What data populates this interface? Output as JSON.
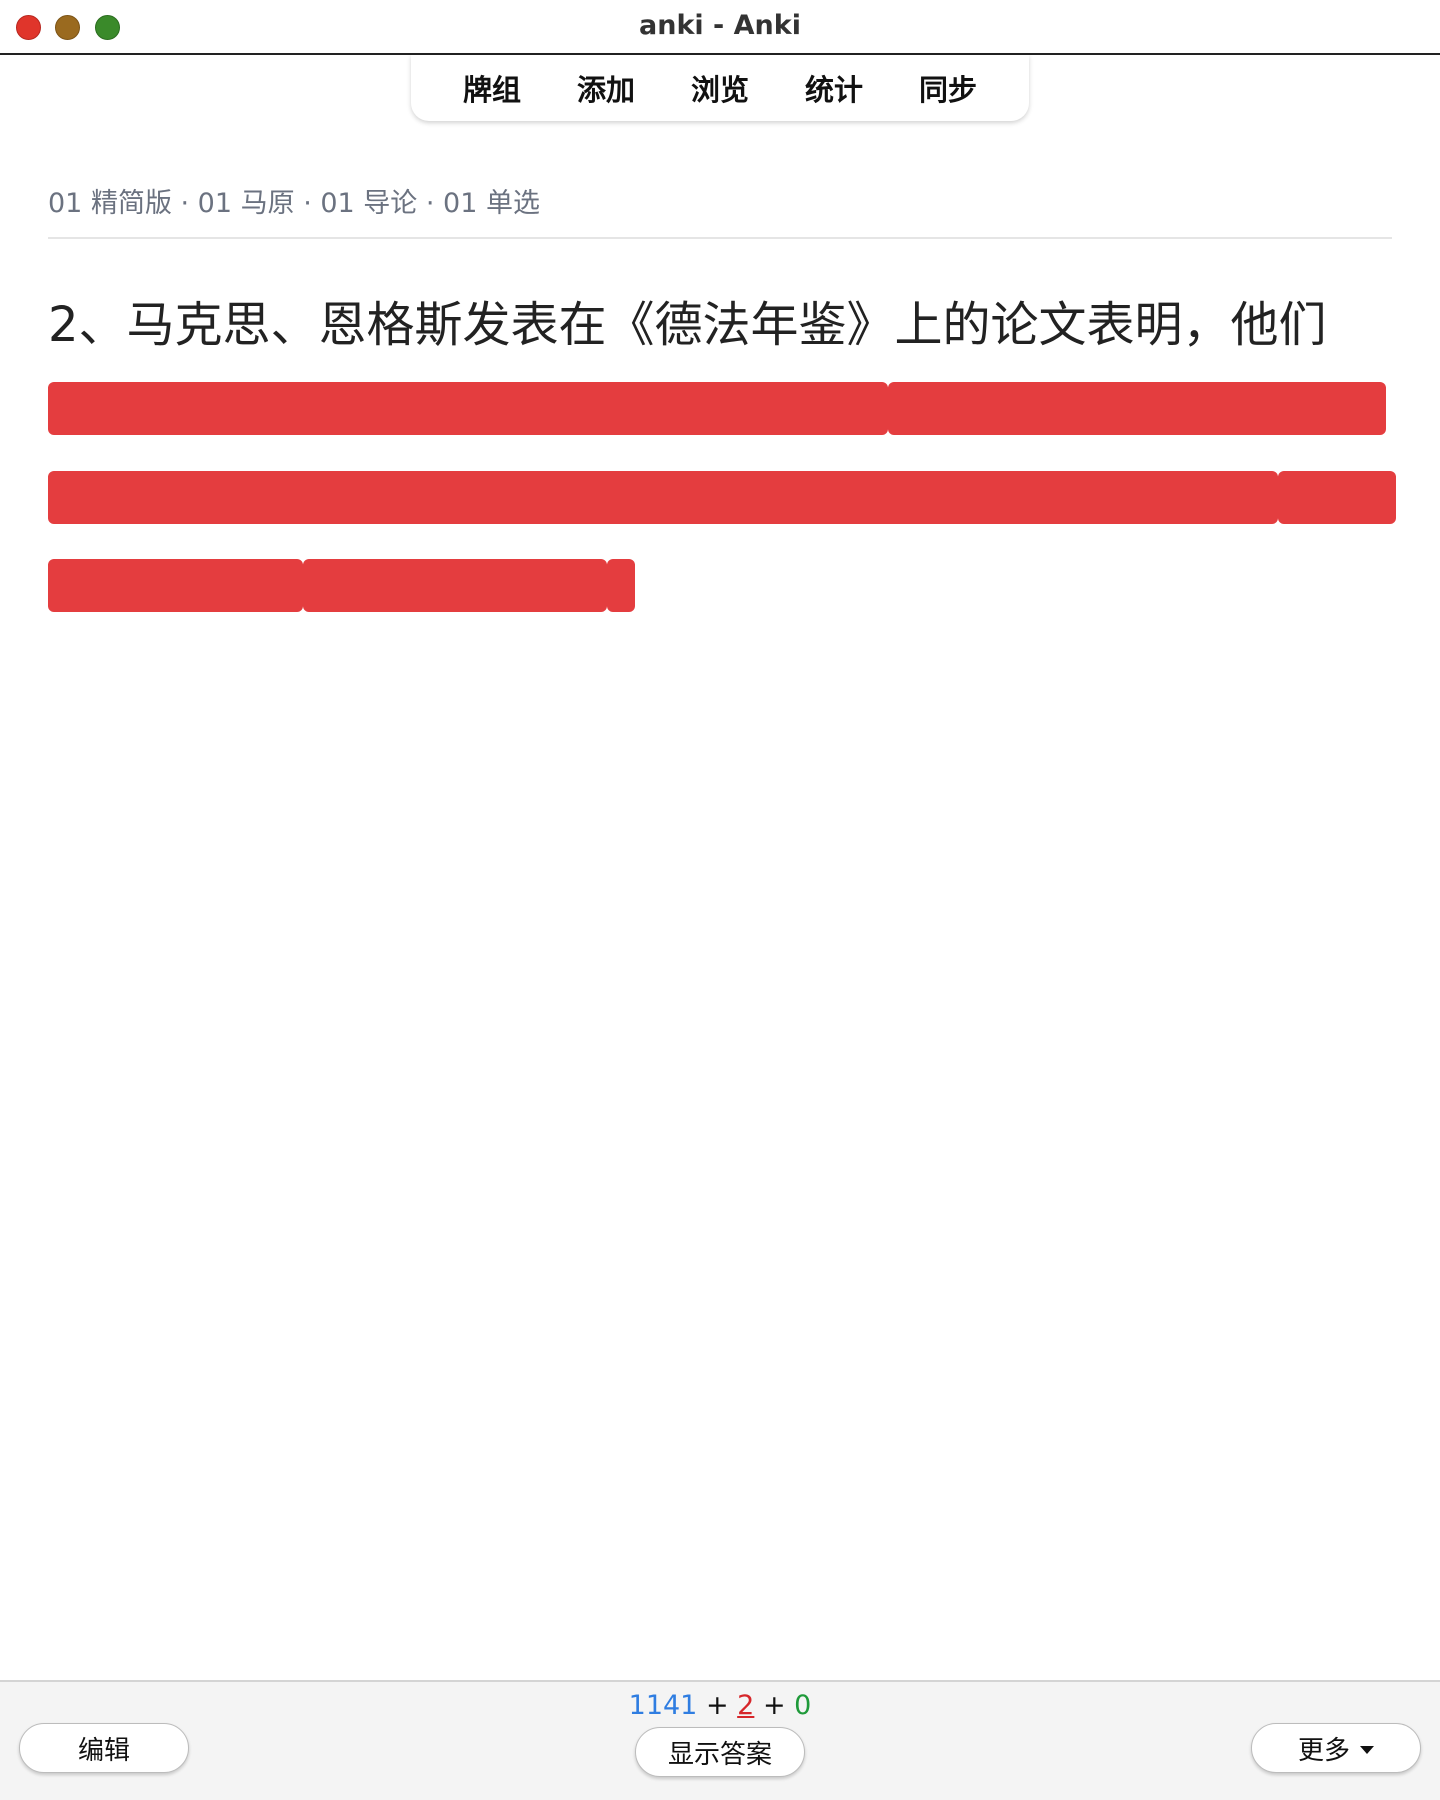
{
  "window": {
    "title": "anki - Anki"
  },
  "toolbar": {
    "items": [
      {
        "label": "牌组"
      },
      {
        "label": "添加"
      },
      {
        "label": "浏览"
      },
      {
        "label": "统计"
      },
      {
        "label": "同步"
      }
    ]
  },
  "card": {
    "deck_path": "01 精简版 · 01 马原 · 01 导论 · 01 单选",
    "question": "2、马克思、恩格斯发表在《德法年鉴》上的论文表明，他们"
  },
  "bottom": {
    "edit_label": "编辑",
    "show_answer_label": "显示答案",
    "more_label": "更多",
    "counts": {
      "new": "1141",
      "sep1": "+",
      "learn": "2",
      "sep2": "+",
      "review": "0"
    }
  },
  "colors": {
    "redaction": "#e43d3f",
    "new_count": "#2f7de1",
    "learn_count": "#d6262a",
    "review_count": "#1f9a3a"
  }
}
